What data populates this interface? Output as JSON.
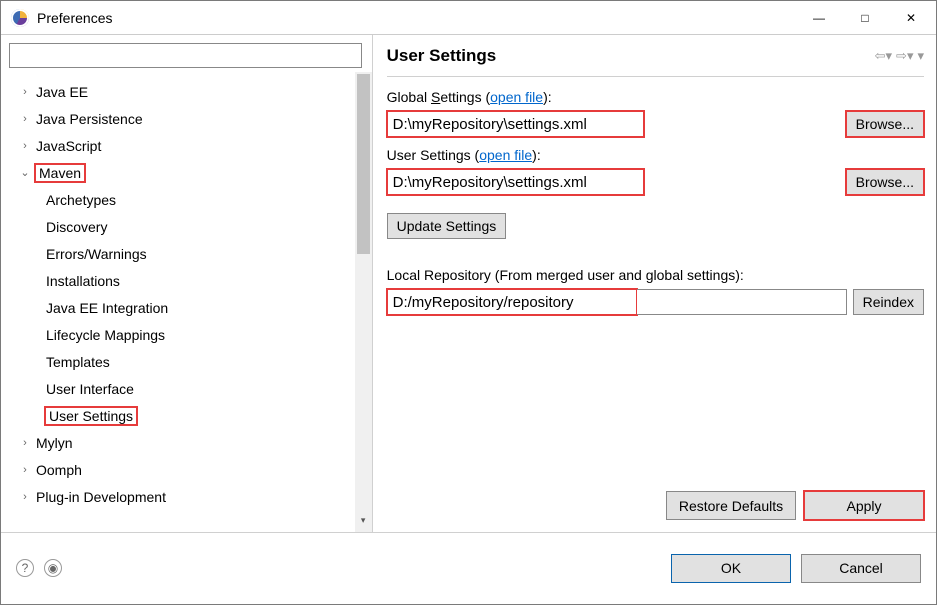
{
  "window": {
    "title": "Preferences"
  },
  "tree": [
    {
      "label": "Java EE",
      "type": "collapsed"
    },
    {
      "label": "Java Persistence",
      "type": "collapsed"
    },
    {
      "label": "JavaScript",
      "type": "collapsed"
    },
    {
      "label": "Maven",
      "type": "expanded",
      "highlight": true,
      "children": [
        {
          "label": "Archetypes"
        },
        {
          "label": "Discovery"
        },
        {
          "label": "Errors/Warnings"
        },
        {
          "label": "Installations"
        },
        {
          "label": "Java EE Integration"
        },
        {
          "label": "Lifecycle Mappings"
        },
        {
          "label": "Templates"
        },
        {
          "label": "User Interface"
        },
        {
          "label": "User Settings",
          "highlight": true
        }
      ]
    },
    {
      "label": "Mylyn",
      "type": "collapsed"
    },
    {
      "label": "Oomph",
      "type": "collapsed"
    },
    {
      "label": "Plug-in Development",
      "type": "collapsed"
    }
  ],
  "panel": {
    "title": "User Settings",
    "global": {
      "label_pre": "Global ",
      "label_mn": "S",
      "label_post": "ettings (",
      "link": "open file",
      "label_end": "):",
      "value": "D:\\myRepository\\settings.xml",
      "browse": "Browse..."
    },
    "user": {
      "label_pre": "User Settings (",
      "link": "open file",
      "label_end": "):",
      "value": "D:\\myRepository\\settings.xml",
      "browse": "Browse..."
    },
    "update_btn": "Update Settings",
    "local_repo": {
      "label": "Local Repository (From merged user and global settings):",
      "value": "D:/myRepository/repository",
      "reindex": "Reindex"
    },
    "restore": "Restore Defaults",
    "apply": "Apply"
  },
  "footer": {
    "ok": "OK",
    "cancel": "Cancel"
  }
}
